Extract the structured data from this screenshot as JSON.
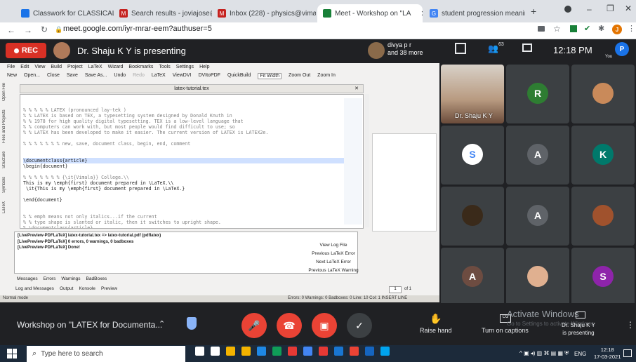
{
  "tabs": [
    {
      "label": "Classwork for CLASSICAL ME",
      "fav": "#1a73e8"
    },
    {
      "label": "Search results - joviajose@g",
      "fav": "#c5221f"
    },
    {
      "label": "Inbox (228) - physics@vimala",
      "fav": "#c5221f"
    },
    {
      "label": "Meet - Workshop on \"LA",
      "fav": "#188038"
    },
    {
      "label": "student progression meaning",
      "fav": "#4285f4"
    }
  ],
  "url": "meet.google.com/iyr-mrar-eem?authuser=5",
  "meet": {
    "rec": "REC",
    "presenter_text": "Dr. Shaju K Y is presenting",
    "people_line1": "divya p r",
    "people_line2": "and 38 more",
    "people_count": "63",
    "clock": "12:18 PM",
    "you_label": "You",
    "profile_initial": "P"
  },
  "latex": {
    "menus": [
      "File",
      "Edit",
      "View",
      "Build",
      "Project",
      "LaTeX",
      "Wizard",
      "Bookmarks",
      "Tools",
      "Settings",
      "Help"
    ],
    "toolbar": [
      "New",
      "Open...",
      "Close",
      "Save",
      "Save As...",
      "Undo",
      "Redo",
      "LaTeX",
      "ViewDVI",
      "DVItoPDF",
      "QuickBuild",
      "Fit Width",
      "Zoom Out",
      "Zoom In"
    ],
    "doc_title": "latex-tutorial.tex",
    "side_tabs": [
      "Open File",
      "Files and Projects",
      "Structure",
      "Symbols",
      "LaTeX"
    ],
    "lines": [
      "% % % % % LATEX (pronounced lay-tek )",
      "% % LATEX is based on TEX, a typesetting system designed by Donald Knuth in",
      "% % 1978 for high quality digital typesetting. TEX is a low-level language that",
      "% % computers can work with, but most people would find difficult to use; so",
      "% % LATEX has been developed to make it easier. The current version of LATEX is LATEX2e.",
      "",
      "% % % % % % % new, save, document class, begin, end, comment",
      "",
      "",
      "\\documentclass{article}",
      "\\begin{document}",
      "",
      "% % % % % % % {\\it{Vimala}} College.\\\\",
      "This is my \\emph{first} document prepared in \\LaTeX.\\\\",
      " \\it{This is my \\emph{first} document prepared in \\LaTeX.}",
      "",
      "\\end{document}",
      "",
      "",
      "% % emph means not only italics...if the current",
      "% % type shape is slanted or italic, then it switches to upright shape.",
      "% \\documentclass{article}",
      "% \\begin{document}"
    ],
    "log": [
      "[LivePreview-PDFLaTeX] latex-tutorial.tex => latex-tutorial.pdf (pdflatex)",
      "[LivePreview-PDFLaTeX] 0 errors, 0 warnings, 0 badboxes",
      "[LivePreview-PDFLaTeX] Done!"
    ],
    "log_buttons": [
      "View Log File",
      "Previous LaTeX Error",
      "Next LaTeX Error",
      "Previous LaTeX Warning"
    ],
    "log_tabs": [
      "Messages",
      "Errors",
      "Warnings",
      "BadBoxes"
    ],
    "bottom_tabs": [
      "Log and Messages",
      "Output",
      "Konsole",
      "Preview"
    ],
    "page_num": "1",
    "page_of": "of 1",
    "status_left": "Normal mode",
    "status_right": "Errors: 0  Warnings: 0  Badboxes: 0    Line: 10 Col: 1  INSERT  LINE"
  },
  "participants": [
    {
      "name": "Dr. Shaju K Y",
      "kind": "video"
    },
    {
      "initial": "R",
      "color": "#2e7d32"
    },
    {
      "initial": "",
      "color": "#c98a5a",
      "kind": "photo"
    },
    {
      "initial": "S",
      "color": "#ffffff",
      "kind": "logo"
    },
    {
      "initial": "A",
      "color": "#5f6368"
    },
    {
      "initial": "K",
      "color": "#00796b"
    },
    {
      "initial": "",
      "color": "#3a2a1a",
      "kind": "photo"
    },
    {
      "initial": "A",
      "color": "#5f6368"
    },
    {
      "initial": "",
      "color": "#a0522d",
      "kind": "photo"
    },
    {
      "initial": "A",
      "color": "#6d4c41"
    },
    {
      "initial": "",
      "color": "#e0b090",
      "kind": "photo"
    },
    {
      "initial": "S",
      "color": "#8e24aa"
    }
  ],
  "bottom": {
    "meeting_title": "Workshop on \"LATEX for Documenta...",
    "raise_hand": "Raise hand",
    "captions": "Turn on captions",
    "presenting_name": "Dr. Shaju K Y",
    "presenting_text": "is presenting",
    "watermark1": "Activate Windows",
    "watermark2": "Go to Settings to activate Windows."
  },
  "taskbar": {
    "search": "Type here to search",
    "time": "12:18",
    "date": "17-03-2021",
    "lang": "ENG"
  }
}
